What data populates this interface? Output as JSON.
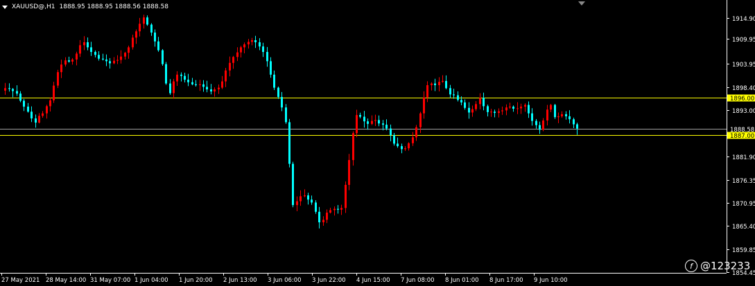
{
  "header": {
    "symbol_tf": "XAUUSD@,H1",
    "ohlc": "1888.95 1888.95 1888.56 1888.58"
  },
  "watermark": {
    "logo_glyph": "f",
    "text": "@123233"
  },
  "colors": {
    "background": "#000000",
    "bull_candle": "#ff0000",
    "bear_candle": "#00ffff",
    "level_line": "#ffff00",
    "bid_line": "#a0a0a0",
    "axis": "#ffffff",
    "label_text": "#ffffff"
  },
  "chart_data": {
    "type": "candlestick",
    "ylim": [
      1854.45,
      1917.5
    ],
    "y_ticks": [
      "1914.90",
      "1909.95",
      "1903.95",
      "1898.40",
      "1893.00",
      "1881.90",
      "1876.35",
      "1870.95",
      "1865.40",
      "1859.85",
      "1854.45"
    ],
    "x_tick_labels": [
      "27 May 2021",
      "28 May 14:00",
      "31 May 07:00",
      "1 Jun 04:00",
      "1 Jun 20:00",
      "2 Jun 13:00",
      "3 Jun 06:00",
      "3 Jun 22:00",
      "4 Jun 15:00",
      "7 Jun 08:00",
      "8 Jun 01:00",
      "8 Jun 17:00",
      "9 Jun 10:00"
    ],
    "price_lines": [
      {
        "price": 1896.0,
        "label": "1896.00",
        "kind": "level"
      },
      {
        "price": 1888.58,
        "label": "1888.58",
        "kind": "bid"
      },
      {
        "price": 1887.0,
        "label": "1887.00",
        "kind": "level"
      }
    ],
    "close_path": [
      1897.6,
      1898.2,
      1898.0,
      1897.5,
      1896.9,
      1895.2,
      1893.8,
      1892.6,
      1891.0,
      1890.0,
      1891.6,
      1892.2,
      1893.9,
      1895.3,
      1898.8,
      1902.0,
      1903.8,
      1904.8,
      1904.5,
      1905.0,
      1906.4,
      1908.4,
      1909.1,
      1907.9,
      1906.8,
      1906.1,
      1905.2,
      1905.0,
      1904.6,
      1904.1,
      1904.7,
      1904.9,
      1905.7,
      1906.6,
      1907.9,
      1910.2,
      1911.7,
      1913.5,
      1915.0,
      1913.3,
      1911.4,
      1909.3,
      1907.2,
      1903.9,
      1899.3,
      1897.0,
      1899.8,
      1901.4,
      1901.1,
      1900.2,
      1899.6,
      1899.1,
      1898.9,
      1899.1,
      1898.5,
      1897.9,
      1897.4,
      1897.9,
      1898.3,
      1899.8,
      1902.4,
      1904.2,
      1905.6,
      1906.7,
      1907.9,
      1908.6,
      1909.2,
      1909.6,
      1909.1,
      1908.1,
      1906.8,
      1904.6,
      1901.4,
      1898.3,
      1896.1,
      1893.6,
      1890.1,
      1880.2,
      1870.4,
      1871.3,
      1872.5,
      1872.7,
      1871.7,
      1871.0,
      1868.8,
      1866.3,
      1866.9,
      1868.6,
      1869.2,
      1869.5,
      1869.3,
      1869.7,
      1875.2,
      1881.1,
      1887.5,
      1891.8,
      1891.4,
      1890.3,
      1889.7,
      1890.4,
      1890.6,
      1889.8,
      1889.5,
      1888.6,
      1887.0,
      1885.0,
      1884.4,
      1883.7,
      1883.9,
      1885.1,
      1886.5,
      1888.9,
      1892.2,
      1896.0,
      1898.9,
      1899.3,
      1898.9,
      1899.7,
      1899.9,
      1898.2,
      1896.7,
      1896.5,
      1895.4,
      1894.8,
      1893.5,
      1892.4,
      1893.2,
      1894.4,
      1895.9,
      1893.9,
      1892.5,
      1892.6,
      1892.3,
      1892.7,
      1892.9,
      1893.6,
      1893.8,
      1893.3,
      1893.4,
      1893.8,
      1894.2,
      1892.2,
      1890.4,
      1889.4,
      1888.3,
      1890.5,
      1893.1,
      1894.2,
      1891.3,
      1891.5,
      1892.0,
      1891.5,
      1890.8,
      1889.6,
      1888.58
    ]
  }
}
